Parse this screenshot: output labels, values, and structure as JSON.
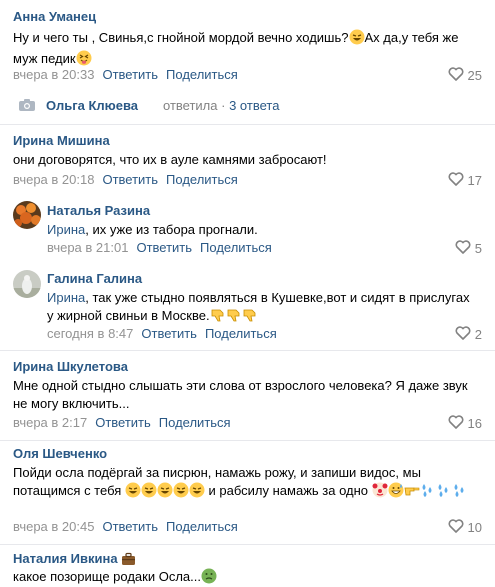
{
  "comments": [
    {
      "author": "Анна Уманец",
      "text": "Ну и чего ты , Свинья,с гнойной мордой вечно ходишь?",
      "text_tail": "Ах да,у тебя же муж педик",
      "time": "вчера в 20:33",
      "reply": "Ответить",
      "share": "Поделиться",
      "likes": "25"
    },
    {
      "author": "Ирина Мишина",
      "text": "они договорятся, что их в ауле камнями забросают!",
      "time": "вчера в 20:18",
      "reply": "Ответить",
      "share": "Поделиться",
      "likes": "17"
    },
    {
      "author": "Наталья Разина",
      "reply_to": "Ирина",
      "text": ", их уже из табора прогнали.",
      "time": "вчера в 21:01",
      "reply": "Ответить",
      "share": "Поделиться",
      "likes": "5"
    },
    {
      "author": "Галина Галина",
      "reply_to": "Ирина",
      "text": ", так уже стыдно появляться в Кушевке,вот и сидят в прислугах у жирной свиньи в Москве.",
      "time": "сегодня в 8:47",
      "reply": "Ответить",
      "share": "Поделиться",
      "likes": "2"
    },
    {
      "author": "Ирина Шкулетова",
      "text": "Мне одной стыдно слышать эти слова от взрослого человека? Я даже звук не могу включить...",
      "time": "вчера в 2:17",
      "reply": "Ответить",
      "share": "Поделиться",
      "likes": "16"
    },
    {
      "author": "Оля Шевченко",
      "text": "Пойди осла подёргай за писрюн, намажь рожу, и запиши видос, мы потащимся с тебя",
      "text_tail": "и рабсилу намажь за одно",
      "time": "вчера в 20:45",
      "reply": "Ответить",
      "share": "Поделиться",
      "likes": "10"
    },
    {
      "author": "Наталия Ивкина",
      "text": "какое позорище родаки Осла..."
    }
  ],
  "thread": {
    "name": "Ольга Клюева",
    "replied": "ответила",
    "separator": "·",
    "count": "3 ответа"
  },
  "colors": {
    "link": "#2a5885",
    "meta": "#939393",
    "divider": "#e7e8ec"
  }
}
